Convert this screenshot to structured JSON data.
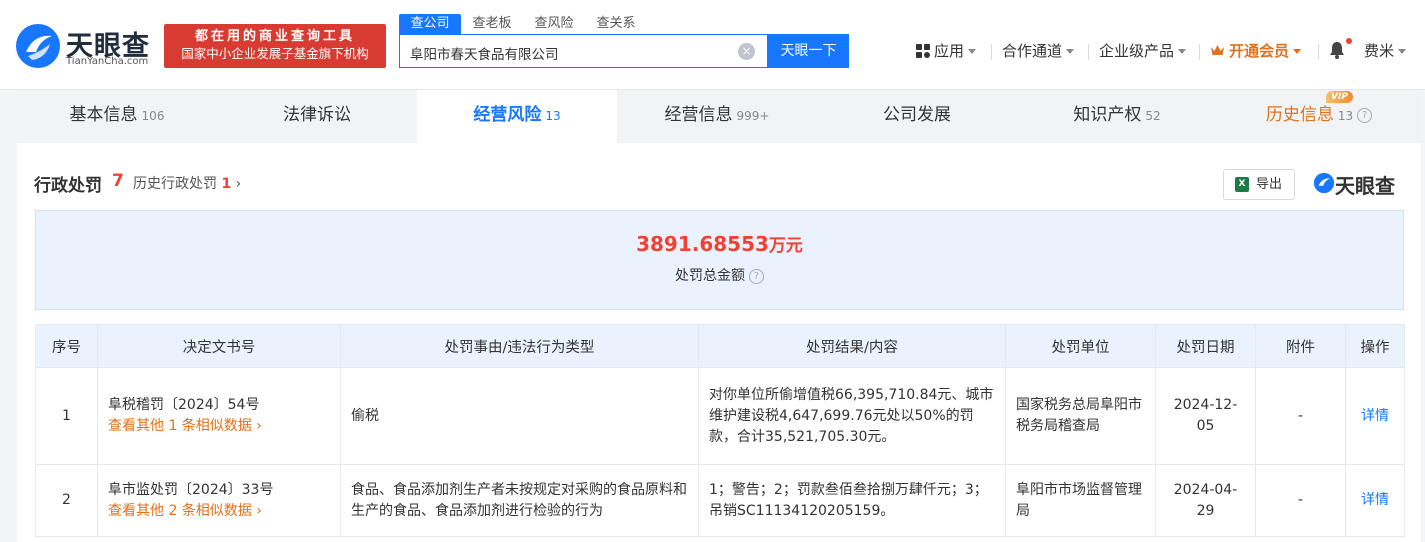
{
  "header": {
    "logo_text": "天眼查",
    "logo_sub": "TianYanCha.com",
    "slogan_line1": "都在用的商业查询工具",
    "slogan_line2": "国家中小企业发展子基金旗下机构",
    "search_tabs": [
      "查公司",
      "查老板",
      "查风险",
      "查关系"
    ],
    "search_value": "阜阳市春天食品有限公司",
    "search_button": "天眼一下",
    "nav": {
      "apps": "应用",
      "partner": "合作通道",
      "enterprise": "企业级产品",
      "vip": "开通会员",
      "user": "费米"
    }
  },
  "tabs": [
    {
      "label": "基本信息",
      "count": "106"
    },
    {
      "label": "法律诉讼",
      "count": ""
    },
    {
      "label": "经营风险",
      "count": "13"
    },
    {
      "label": "经营信息",
      "count": "999+"
    },
    {
      "label": "公司发展",
      "count": ""
    },
    {
      "label": "知识产权",
      "count": "52"
    },
    {
      "label": "历史信息",
      "count": "13"
    }
  ],
  "vip_badge": "VIP",
  "section": {
    "title": "行政处罚",
    "count": "7",
    "history_label": "历史行政处罚",
    "history_count": "1",
    "export_label": "导出",
    "watermark": "天眼查"
  },
  "summary": {
    "value": "3891.68553",
    "unit": "万元",
    "label": "处罚总金额"
  },
  "table": {
    "headers": [
      "序号",
      "决定文书号",
      "处罚事由/违法行为类型",
      "处罚结果/内容",
      "处罚单位",
      "处罚日期",
      "附件",
      "操作"
    ],
    "rows": [
      {
        "no": "1",
        "doc": "阜税稽罚〔2024〕54号",
        "similar": "查看其他 1 条相似数据",
        "reason": "偷税",
        "result": "对你单位所偷增值税66,395,710.84元、城市维护建设税4,647,699.76元处以50%的罚款，合计35,521,705.30元。",
        "unit": "国家税务总局阜阳市税务局稽查局",
        "date": "2024-12-05",
        "attachment": "-",
        "action": "详情"
      },
      {
        "no": "2",
        "doc": "阜市监处罚〔2024〕33号",
        "similar": "查看其他 2 条相似数据",
        "reason": "食品、食品添加剂生产者未按规定对采购的食品原料和生产的食品、食品添加剂进行检验的行为",
        "result": "1；警告；2；罚款叁佰叁拾捌万肆仟元；3；吊销SC11134120205159。",
        "unit": "阜阳市市场监督管理局",
        "date": "2024-04-29",
        "attachment": "-",
        "action": "详情"
      }
    ]
  },
  "colors": {
    "brand_blue": "#1777ff",
    "red": "#f04134",
    "orange": "#e3711a"
  }
}
